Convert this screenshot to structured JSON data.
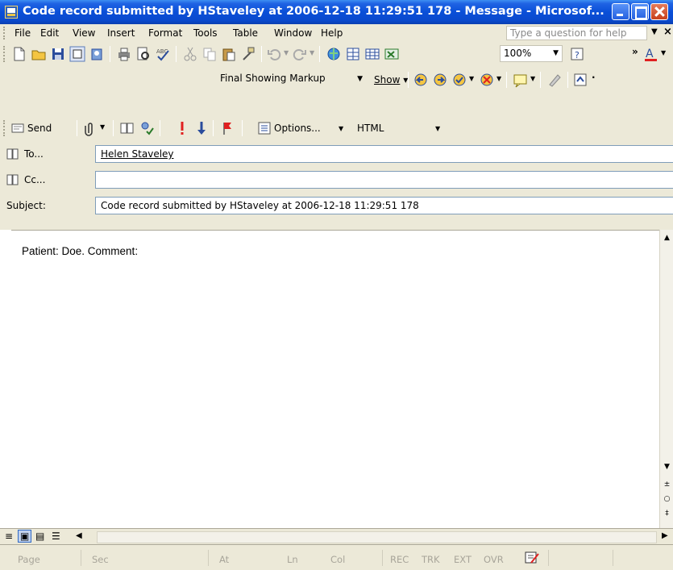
{
  "window": {
    "title": "Code record submitted by HStaveley at 2006-12-18 11:29:51 178 - Message - Microsof..."
  },
  "menu": {
    "items": [
      "File",
      "Edit",
      "View",
      "Insert",
      "Format",
      "Tools",
      "Table",
      "Window",
      "Help"
    ],
    "help_placeholder": "Type a question for help"
  },
  "toolbar": {
    "zoom": "100%",
    "markup_view": "Final Showing Markup",
    "show_label": "Show"
  },
  "mail_toolbar": {
    "send_label": "Send",
    "options_label": "Options...",
    "format": "HTML"
  },
  "fields": {
    "to_label": "To...",
    "to_value": "Helen Staveley",
    "cc_label": "Cc...",
    "cc_value": "",
    "subject_label": "Subject:",
    "subject_value": "Code record submitted by HStaveley at 2006-12-18 11:29:51 178"
  },
  "body": {
    "text": "Patient: Doe. Comment:"
  },
  "status": {
    "items": [
      "Page",
      "Sec",
      "At",
      "Ln",
      "Col",
      "REC",
      "TRK",
      "EXT",
      "OVR"
    ]
  },
  "colors": {
    "titlebar": "#0a4fd8",
    "chrome": "#ece9d8",
    "accent_red": "#e02020"
  }
}
